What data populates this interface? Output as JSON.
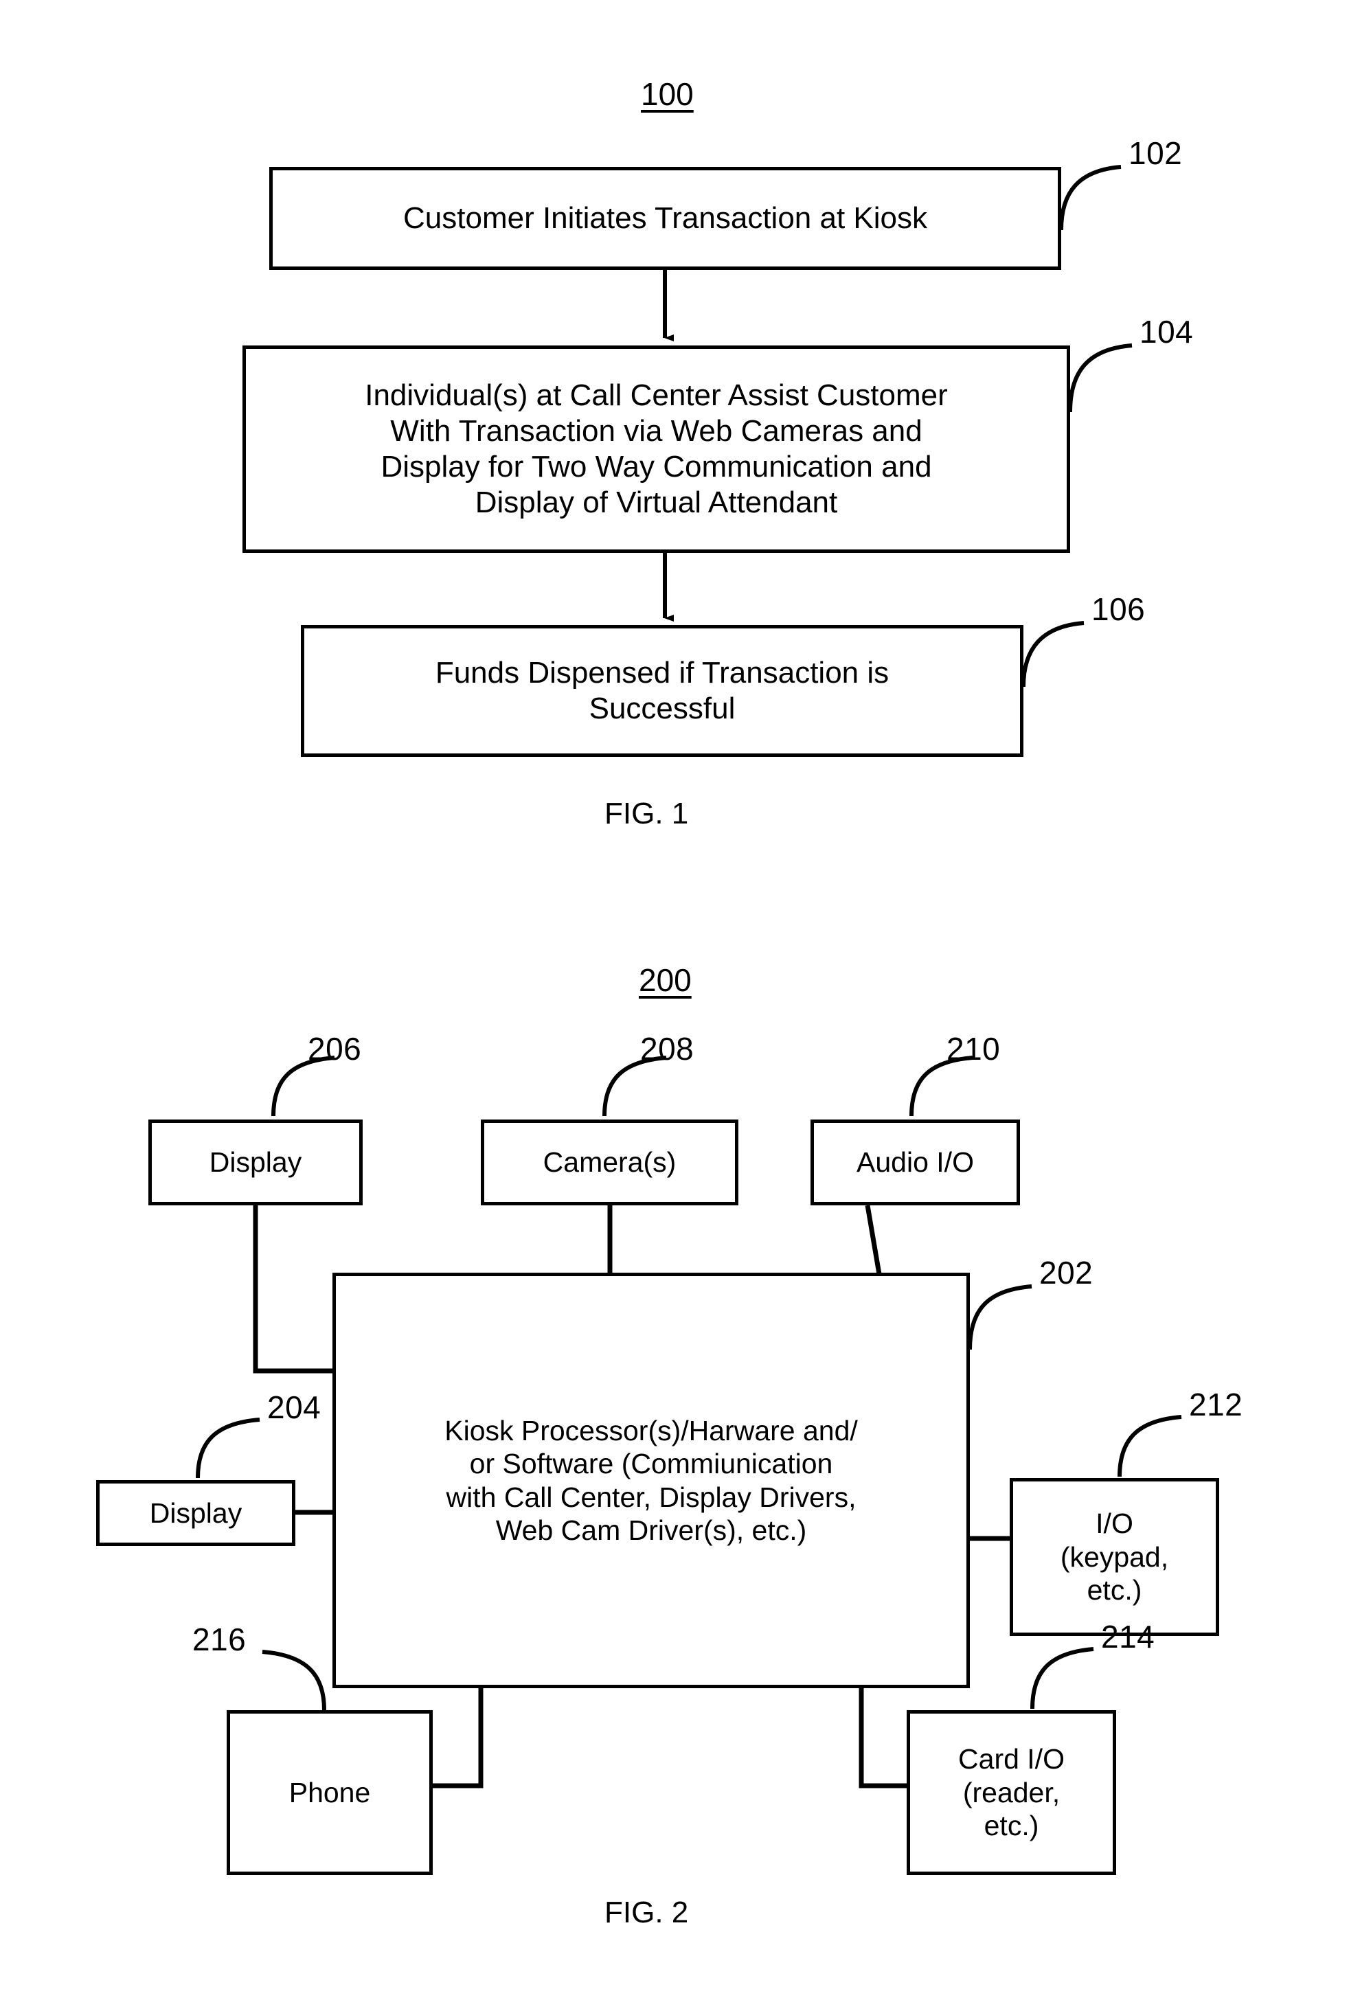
{
  "figures": [
    {
      "id": "fig-1",
      "caption": "FIG. 1",
      "diagram_number": "100",
      "nodes": [
        {
          "ref": "102",
          "text": "Customer Initiates Transaction at Kiosk"
        },
        {
          "ref": "104",
          "text": "Individual(s) at Call Center Assist Customer\nWith Transaction via Web Cameras and\nDisplay for Two Way Communication and\nDisplay of Virtual Attendant"
        },
        {
          "ref": "106",
          "text": "Funds Dispensed if Transaction is\nSuccessful"
        }
      ]
    },
    {
      "id": "fig-2",
      "caption": "FIG. 2",
      "diagram_number": "200",
      "nodes": [
        {
          "ref": "206",
          "text": "Display"
        },
        {
          "ref": "208",
          "text": "Camera(s)"
        },
        {
          "ref": "210",
          "text": "Audio I/O"
        },
        {
          "ref": "202",
          "text": "Kiosk Processor(s)/Harware and/\nor Software (Commiunication\nwith Call Center, Display Drivers,\nWeb Cam Driver(s), etc.)"
        },
        {
          "ref": "204",
          "text": "Display"
        },
        {
          "ref": "212",
          "text": "I/O\n(keypad,\netc.)"
        },
        {
          "ref": "214",
          "text": "Card I/O\n(reader,\netc.)"
        },
        {
          "ref": "216",
          "text": "Phone"
        }
      ]
    }
  ],
  "colors": {
    "stroke": "#000000",
    "background": "#ffffff"
  }
}
